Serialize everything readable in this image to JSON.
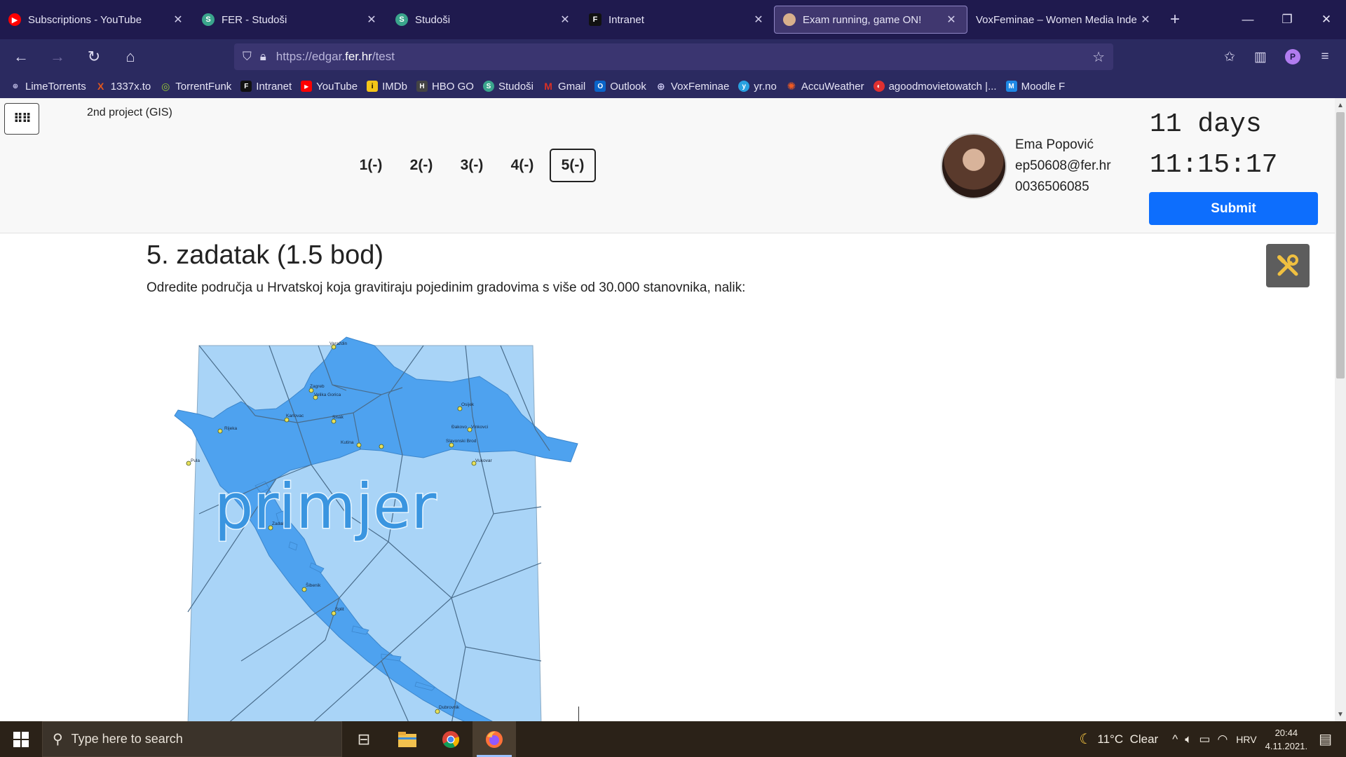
{
  "tabs": [
    {
      "title": "Subscriptions - YouTube",
      "icon": "youtube-icon",
      "color": "#ff0000",
      "glyph": "▶"
    },
    {
      "title": "FER - Studoši",
      "icon": "studosi-icon",
      "color": "#3aa58c",
      "glyph": "S"
    },
    {
      "title": "Studoši",
      "icon": "studosi-icon",
      "color": "#3aa58c",
      "glyph": "S"
    },
    {
      "title": "Intranet",
      "icon": "fer-icon",
      "color": "#111111",
      "glyph": "F"
    },
    {
      "title": "Exam running, game ON!",
      "icon": "exam-icon",
      "color": "#d8b08c",
      "glyph": "●",
      "active": true
    },
    {
      "title": "VoxFeminae – Women Media Inde",
      "icon": "voxfeminae-icon",
      "color": "#1f1a4e",
      "glyph": ""
    }
  ],
  "url": {
    "prefix": "https://edgar.",
    "domain": "fer.hr",
    "path": "/test"
  },
  "bookmarks": [
    {
      "label": "LimeTorrents",
      "color": "#6b6bb8",
      "glyph": "⊕"
    },
    {
      "label": "1337x.to",
      "color": "#e2571d",
      "glyph": "X"
    },
    {
      "label": "TorrentFunk",
      "color": "#9acd32",
      "glyph": "◎"
    },
    {
      "label": "Intranet",
      "color": "#111111",
      "glyph": "F"
    },
    {
      "label": "YouTube",
      "color": "#ff0000",
      "glyph": "▶"
    },
    {
      "label": "IMDb",
      "color": "#f5c518",
      "glyph": "i"
    },
    {
      "label": "HBO GO",
      "color": "#444444",
      "glyph": "H"
    },
    {
      "label": "Studoši",
      "color": "#3aa58c",
      "glyph": "S"
    },
    {
      "label": "Gmail",
      "color": "#d93025",
      "glyph": "M"
    },
    {
      "label": "Outlook",
      "color": "#0a64c8",
      "glyph": "O"
    },
    {
      "label": "VoxFeminae",
      "color": "#6b6bb8",
      "glyph": "⊕"
    },
    {
      "label": "yr.no",
      "color": "#28a0e0",
      "glyph": "y"
    },
    {
      "label": "AccuWeather",
      "color": "#ef5a22",
      "glyph": "✺"
    },
    {
      "label": "agoodmovietowatch |...",
      "color": "#e03030",
      "glyph": "◐"
    },
    {
      "label": "Moodle F",
      "color": "#1e88e5",
      "glyph": "M"
    }
  ],
  "header": {
    "project": "2nd project (GIS)",
    "questions": [
      "1(-)",
      "2(-)",
      "3(-)",
      "4(-)",
      "5(-)"
    ],
    "current_question": 5,
    "user": {
      "name": "Ema Popović",
      "email": "ep50608@fer.hr",
      "id": "0036506085"
    },
    "timer_days": "11 days",
    "timer_time": "11:15:17",
    "submit_label": "Submit"
  },
  "question": {
    "title": "5. zadatak (1.5 bod)",
    "text": "Odredite područja u Hrvatskoj koja gravitiraju pojedinim gradovima s više od 30.000 stanovnika, nalik:",
    "image_watermark": "primjer",
    "cities": [
      "Varaždin",
      "Zagreb",
      "Velika Gorica",
      "Karlovac",
      "Sisak",
      "Rijeka",
      "Pula",
      "Kutina",
      "Slavonski Brod",
      "Osijek",
      "Vinkovci",
      "Đakovo",
      "Vukovar",
      "Zadar",
      "Šibenik",
      "Split",
      "Dubrovnik"
    ]
  },
  "taskbar": {
    "search_placeholder": "Type here to search",
    "weather": "11°C  Clear",
    "language": "HRV",
    "time": "20:44",
    "date": "4.11.2021."
  },
  "colors": {
    "map_fill": "#4ea2ef",
    "map_background": "#a9d4f7",
    "voronoi_lines": "#4a6d8c",
    "submit": "#0d6efd"
  }
}
